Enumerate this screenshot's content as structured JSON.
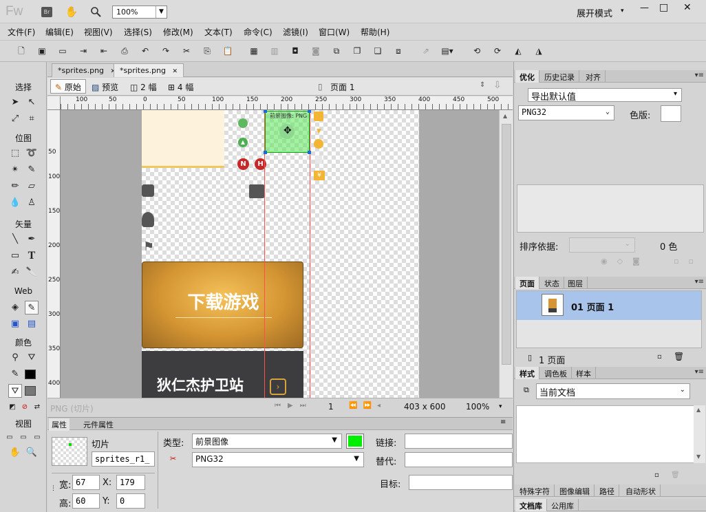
{
  "app": {
    "logo": "Fw",
    "br_badge": "Br",
    "zoom_box": "100%",
    "workspace": "展开模式",
    "window_controls": [
      "—",
      "□",
      "✕"
    ]
  },
  "menu": [
    "文件(F)",
    "编辑(E)",
    "视图(V)",
    "选择(S)",
    "修改(M)",
    "文本(T)",
    "命令(C)",
    "滤镜(I)",
    "窗口(W)",
    "帮助(H)"
  ],
  "tools": {
    "sections": [
      "选择",
      "位图",
      "矢量",
      "Web",
      "颜色",
      "视图"
    ],
    "colors": {
      "stroke": "#000000",
      "fill": "#777777"
    }
  },
  "document": {
    "tabs": [
      {
        "label": "*sprites.png",
        "close": "✕"
      },
      {
        "label": "*sprites.png",
        "close": "✕"
      }
    ],
    "view_modes": [
      "原始",
      "预览",
      "2 幅",
      "4 幅"
    ],
    "page_label": "页面 1",
    "ruler_top": [
      "100",
      "50",
      "0",
      "50",
      "100",
      "150",
      "200",
      "250",
      "300",
      "350",
      "400",
      "450",
      "500"
    ],
    "ruler_left": [
      "50",
      "100",
      "150",
      "200",
      "250",
      "300",
      "350",
      "400"
    ],
    "canvas": {
      "slice_label": "前景图像: PNG",
      "banner1_text": "下载游戏",
      "banner2_text": "狄仁杰护卫站",
      "badges": [
        "N",
        "H"
      ]
    },
    "status": {
      "format": "PNG (切片)",
      "frame": "1",
      "size": "403 x 600",
      "zoom": "100%"
    }
  },
  "properties": {
    "tabs": [
      "属性",
      "元件属性"
    ],
    "kind": "切片",
    "name": "sprites_r1_",
    "width_label": "宽:",
    "width": "67",
    "height_label": "高:",
    "height": "60",
    "x_label": "X:",
    "x": "179",
    "y_label": "Y:",
    "y": "0",
    "type_label": "类型:",
    "type_value": "前景图像",
    "format_value": "PNG32",
    "slice_color": "#00ee00",
    "link_label": "链接:",
    "alt_label": "替代:",
    "target_label": "目标:"
  },
  "optimize": {
    "tabs": [
      "优化",
      "历史记录",
      "对齐"
    ],
    "preset": "导出默认值",
    "format": "PNG32",
    "matte_label": "色版:",
    "sort_label": "排序依据:",
    "color_count": "0 色"
  },
  "pages": {
    "tabs": [
      "页面",
      "状态",
      "图层"
    ],
    "item": "01 页面 1",
    "count": "1 页面"
  },
  "styles": {
    "tabs": [
      "样式",
      "调色板",
      "样本"
    ],
    "scope": "当前文档"
  },
  "bottom_tabs": [
    "特殊字符",
    "图像编辑",
    "路径",
    "自动形状"
  ],
  "bottom_tabs2": [
    "文档库",
    "公用库"
  ]
}
